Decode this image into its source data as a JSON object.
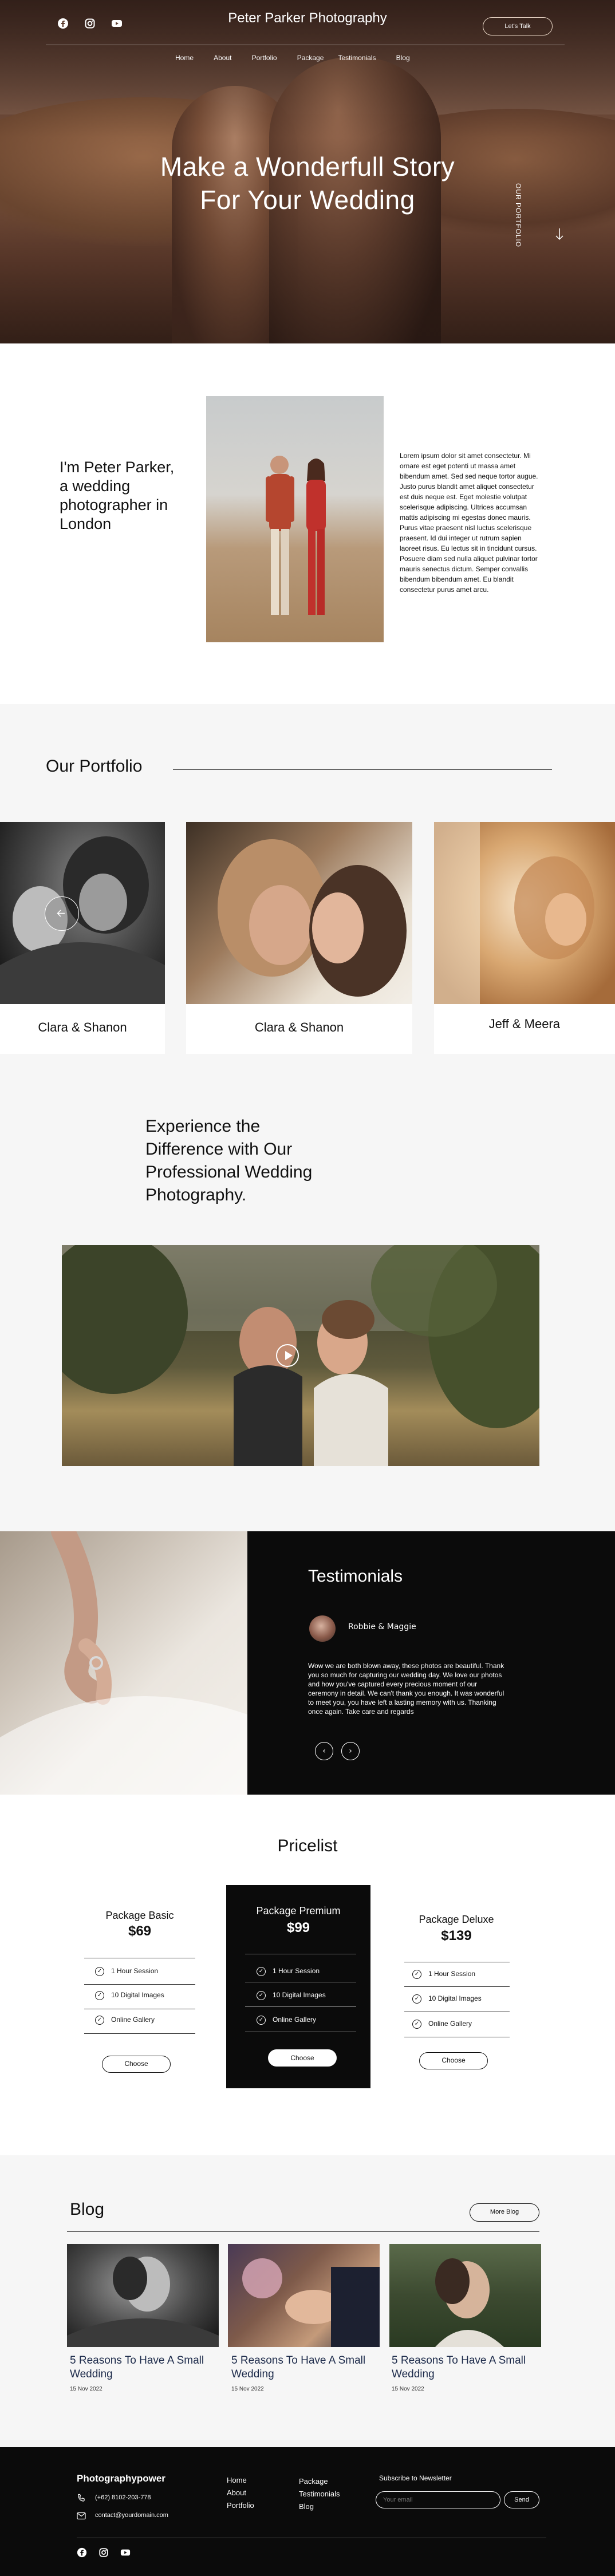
{
  "header": {
    "brand": "Peter Parker Photography",
    "cta": "Let's Talk",
    "nav": [
      "Home",
      "About",
      "Portfolio",
      "Package",
      "Testimonials",
      "Blog"
    ],
    "social_icons": [
      "facebook-icon",
      "instagram-icon",
      "youtube-icon"
    ]
  },
  "hero": {
    "title_line1": "Make a Wonderfull Story",
    "title_line2": "For Your Wedding",
    "side_label": "OUR PORTFOLIO"
  },
  "about": {
    "heading_line1": "I'm Peter Parker,",
    "heading_line2": "a wedding",
    "heading_line3": "photographer in",
    "heading_line4": "London",
    "body_lines": [
      "Lorem ipsum dolor sit amet consectetur. Mi",
      "ornare est eget potenti ut massa amet",
      "bibendum amet. Sed sed neque tortor augue.",
      "Justo purus blandit amet aliquet consectetur",
      "est duis neque est. Eget molestie volutpat",
      "scelerisque adipiscing. Ultrices accumsan",
      "mattis adipiscing mi egestas donec mauris.",
      "Purus vitae praesent nisl luctus scelerisque",
      "praesent. Id dui integer ut rutrum sapien",
      "laoreet risus. Eu lectus sit in tincidunt cursus.",
      "Posuere diam sed nulla aliquet pulvinar tortor",
      "mauris senectus dictum. Semper convallis",
      "bibendum bibendum amet. Eu blandit",
      "consectetur purus amet arcu."
    ]
  },
  "portfolio": {
    "title": "Our Portfolio",
    "items": [
      {
        "caption": "Clara & Shanon"
      },
      {
        "caption": "Clara & Shanon"
      },
      {
        "caption": "Jeff & Meera"
      }
    ],
    "prev_icon": "arrow-left-icon"
  },
  "experience": {
    "line1": "Experience the",
    "line2": "Difference with Our",
    "line3": "Professional Wedding",
    "line4": "Photography.",
    "play_icon": "play-icon"
  },
  "testimonials": {
    "title": "Testimonials",
    "author": "Robbie & Maggie",
    "quote_lines": [
      "Wow we are both blown away, these photos are beautiful. Thank",
      "you so much for capturing our wedding day. We love our photos",
      "and how you've captured every precious moment of our",
      "ceremony in detail. We can't thank you enough. It was wonderful",
      "to meet you, you have left a lasting memory with us. Thanking",
      "once again. Take care and regards"
    ],
    "prev_icon": "chevron-left-icon",
    "next_icon": "chevron-right-icon"
  },
  "pricelist": {
    "title": "Pricelist",
    "packages": [
      {
        "name": "Package Basic",
        "price": "$69",
        "features": [
          "1 Hour Session",
          "10 Digital Images",
          "Online Gallery"
        ],
        "button": "Choose"
      },
      {
        "name": "Package Premium",
        "price": "$99",
        "features": [
          "1 Hour Session",
          "10 Digital Images",
          "Online Gallery"
        ],
        "button": "Choose"
      },
      {
        "name": "Package Deluxe",
        "price": "$139",
        "features": [
          "1 Hour Session",
          "10 Digital Images",
          "Online Gallery"
        ],
        "button": "Choose"
      }
    ]
  },
  "blog": {
    "title": "Blog",
    "more": "More Blog",
    "posts": [
      {
        "title_line1": "5 Reasons To Have A Small",
        "title_line2": "Wedding",
        "date": "15 Nov 2022"
      },
      {
        "title_line1": "5 Reasons To Have A Small",
        "title_line2": "Wedding",
        "date": "15 Nov 2022"
      },
      {
        "title_line1": "5 Reasons To Have A Small",
        "title_line2": "Wedding",
        "date": "15 Nov 2022"
      }
    ]
  },
  "footer": {
    "brand": "Photographypower",
    "phone": "(+62) 8102-203-778",
    "email": "contact@yourdomain.com",
    "col1": [
      "Home",
      "About",
      "Portfolio"
    ],
    "col2": [
      "Package",
      "Testimonials",
      "Blog"
    ],
    "newsletter_title": "Subscribe to Newsletter",
    "email_placeholder": "Your email",
    "send": "Send",
    "social_icons": [
      "facebook-icon",
      "instagram-icon",
      "youtube-icon"
    ]
  },
  "colors": {
    "dark": "#0b0b0b",
    "light_bg": "#f6f6f6",
    "text": "#111111",
    "blog_title": "#1c2a4a"
  }
}
